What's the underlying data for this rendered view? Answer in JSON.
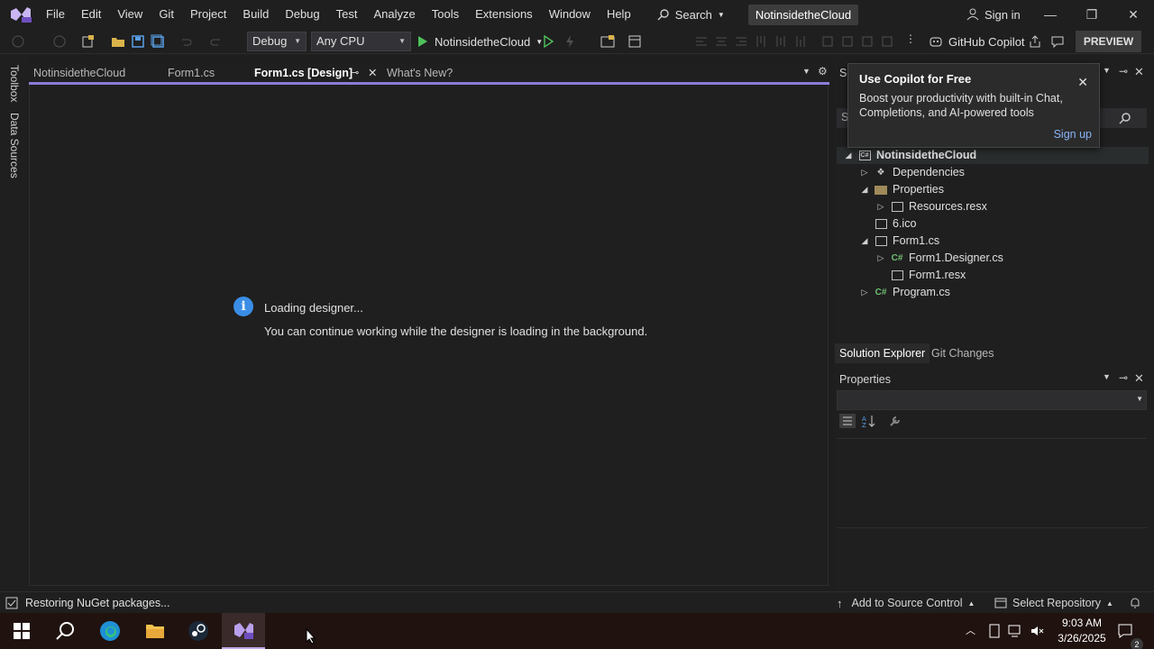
{
  "menubar": {
    "items": [
      "File",
      "Edit",
      "View",
      "Git",
      "Project",
      "Build",
      "Debug",
      "Test",
      "Analyze",
      "Tools",
      "Extensions",
      "Window",
      "Help"
    ],
    "search_label": "Search",
    "project_name": "NotinsidetheCloud",
    "signin_label": "Sign in"
  },
  "toolbar": {
    "config": "Debug",
    "platform": "Any CPU",
    "run_target": "NotinsidetheCloud",
    "copilot_label": "GitHub Copilot",
    "preview_label": "PREVIEW"
  },
  "left_rail": {
    "toolbox": "Toolbox",
    "data_sources": "Data Sources"
  },
  "tabs": [
    "NotinsidetheCloud",
    "Form1.cs",
    "Form1.cs [Design]",
    "What's New?"
  ],
  "editor": {
    "loading_title": "Loading designer...",
    "loading_msg": "You can continue working while the designer is loading in the background."
  },
  "copilot_popup": {
    "title": "Use Copilot for Free",
    "body": "Boost your productivity with built-in Chat, Completions, and AI-powered tools",
    "signup": "Sign up"
  },
  "solution_explorer": {
    "header_fragment": "So",
    "search_fragment": "S",
    "project": "NotinsidetheCloud",
    "items": {
      "dependencies": "Dependencies",
      "properties": "Properties",
      "resources": "Resources.resx",
      "ico": "6.ico",
      "form1": "Form1.cs",
      "form1_designer": "Form1.Designer.cs",
      "form1_resx": "Form1.resx",
      "program": "Program.cs"
    },
    "tabs": [
      "Solution Explorer",
      "Git Changes"
    ]
  },
  "properties_panel": {
    "title": "Properties"
  },
  "statusbar": {
    "status": "Restoring NuGet packages...",
    "source_control": "Add to Source Control",
    "repository": "Select Repository"
  },
  "taskbar": {
    "time": "9:03 AM",
    "date": "3/26/2025",
    "notification_count": "2"
  },
  "colors": {
    "accent": "#8c7bd9",
    "info_blue": "#3a8ee6",
    "link": "#8ab4f8"
  }
}
